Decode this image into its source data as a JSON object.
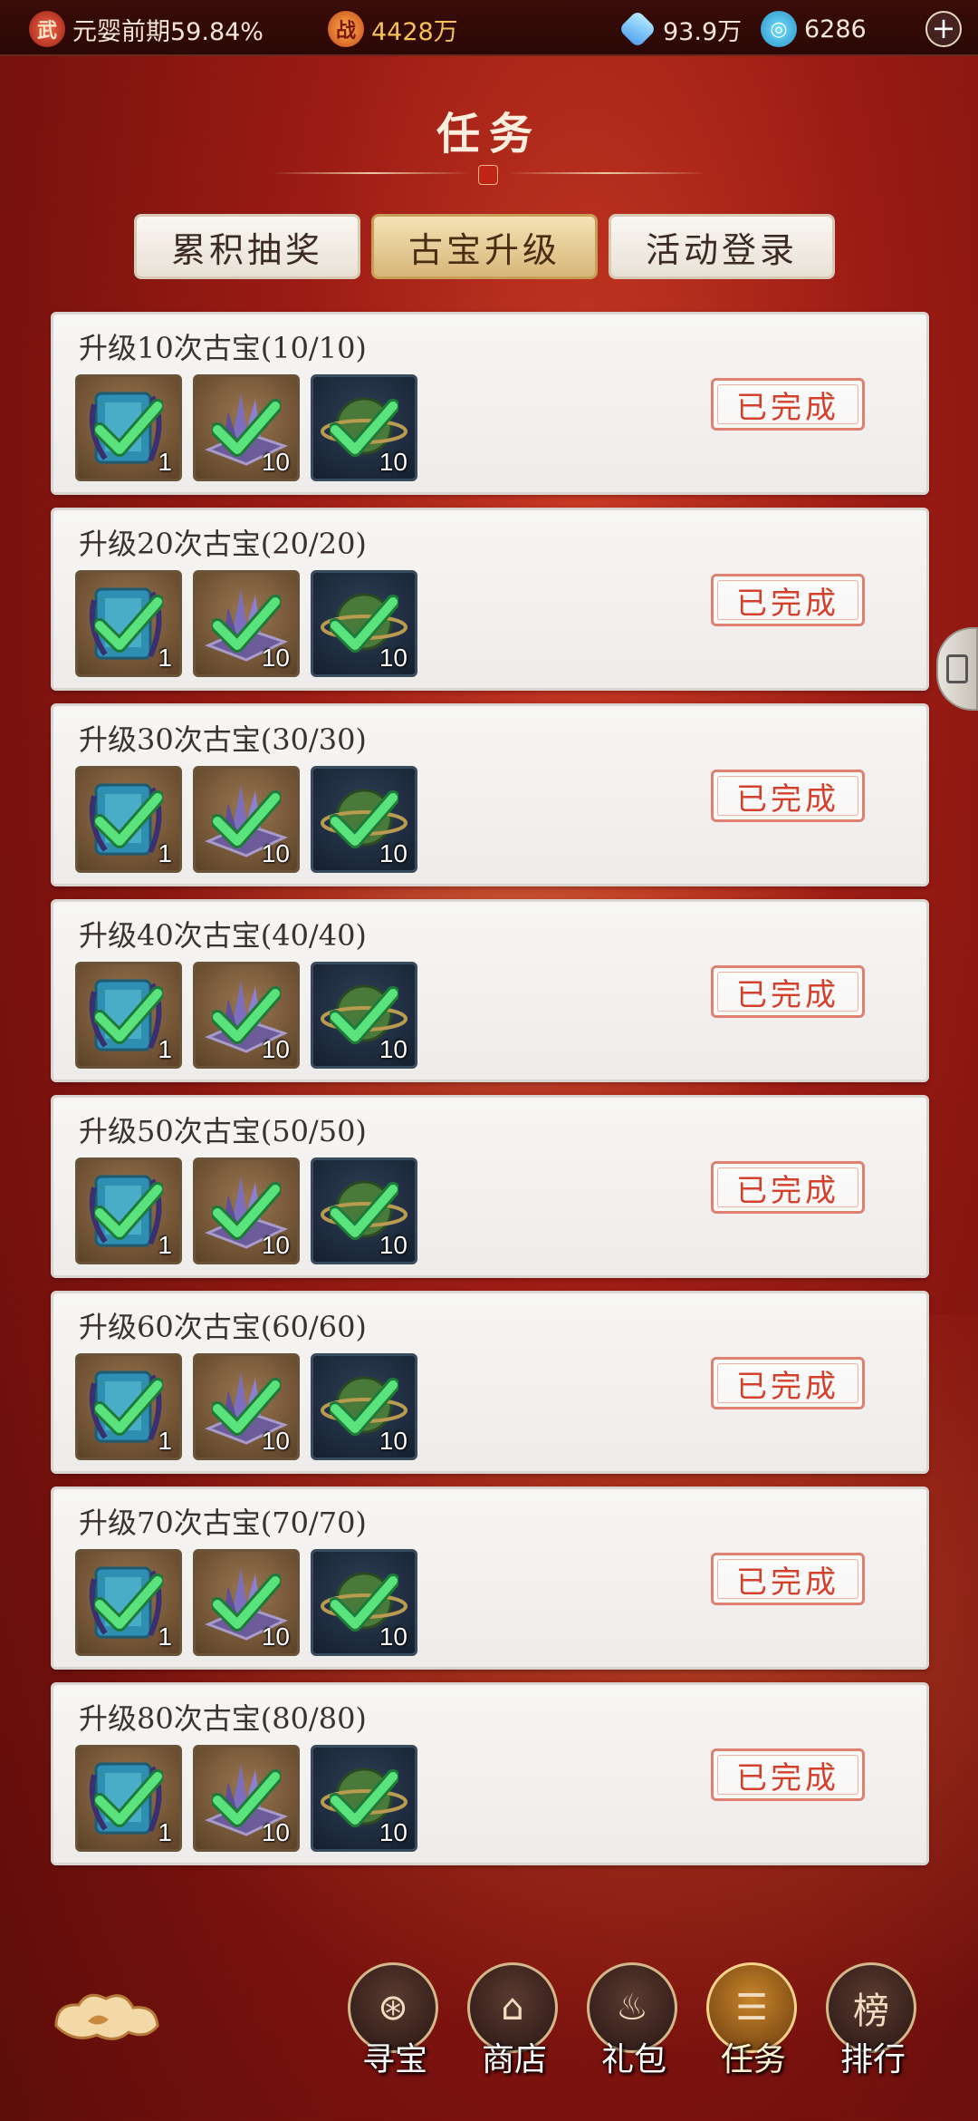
{
  "topbar": {
    "realm_icon": "wu",
    "realm_text": "元婴前期59.84%",
    "power_icon": "zhan",
    "power_value": "4428万",
    "crystal_value": "93.9万",
    "swirl_value": "6286",
    "plus_label": "+"
  },
  "page": {
    "title": "任务"
  },
  "tabs": [
    {
      "label": "累积抽奖",
      "active": false
    },
    {
      "label": "古宝升级",
      "active": true
    },
    {
      "label": "活动登录",
      "active": false
    }
  ],
  "tasks": [
    {
      "title": "升级10次古宝(10/10)",
      "rewards": [
        "1",
        "10",
        "10"
      ],
      "status": "已完成"
    },
    {
      "title": "升级20次古宝(20/20)",
      "rewards": [
        "1",
        "10",
        "10"
      ],
      "status": "已完成"
    },
    {
      "title": "升级30次古宝(30/30)",
      "rewards": [
        "1",
        "10",
        "10"
      ],
      "status": "已完成"
    },
    {
      "title": "升级40次古宝(40/40)",
      "rewards": [
        "1",
        "10",
        "10"
      ],
      "status": "已完成"
    },
    {
      "title": "升级50次古宝(50/50)",
      "rewards": [
        "1",
        "10",
        "10"
      ],
      "status": "已完成"
    },
    {
      "title": "升级60次古宝(60/60)",
      "rewards": [
        "1",
        "10",
        "10"
      ],
      "status": "已完成"
    },
    {
      "title": "升级70次古宝(70/70)",
      "rewards": [
        "1",
        "10",
        "10"
      ],
      "status": "已完成"
    },
    {
      "title": "升级80次古宝(80/80)",
      "rewards": [
        "1",
        "10",
        "10"
      ],
      "status": "已完成"
    }
  ],
  "bottom_nav": [
    {
      "label": "寻宝",
      "icon": "treasure-hunt-icon",
      "active": false
    },
    {
      "label": "商店",
      "icon": "shop-icon",
      "active": false
    },
    {
      "label": "礼包",
      "icon": "gift-bag-icon",
      "active": false
    },
    {
      "label": "任务",
      "icon": "task-scroll-icon",
      "active": true
    },
    {
      "label": "排行",
      "icon": "ranking-icon",
      "active": false
    }
  ],
  "colors": {
    "background": "#9c1c14",
    "tab_active": "#d7b77a",
    "stamp_red": "#d4402c",
    "check_green": "#4fd870"
  }
}
